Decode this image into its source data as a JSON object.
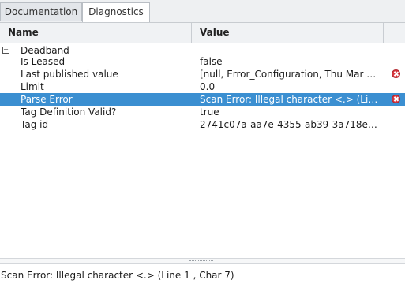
{
  "tabs": [
    {
      "label": "Documentation",
      "active": false
    },
    {
      "label": "Diagnostics",
      "active": true
    }
  ],
  "table": {
    "columns": {
      "name": "Name",
      "value": "Value"
    },
    "rows": [
      {
        "name": "Deadband",
        "value": "",
        "expandable": true,
        "error": false,
        "selected": false
      },
      {
        "name": "Is Leased",
        "value": "false",
        "expandable": false,
        "error": false,
        "selected": false
      },
      {
        "name": "Last published value",
        "value": "[null, Error_Configuration, Thu Mar 28 ...",
        "expandable": false,
        "error": true,
        "selected": false
      },
      {
        "name": "Limit",
        "value": "0.0",
        "expandable": false,
        "error": false,
        "selected": false
      },
      {
        "name": "Parse Error",
        "value": "Scan Error: Illegal character <.> (Line ...",
        "expandable": false,
        "error": true,
        "selected": true
      },
      {
        "name": "Tag Definition Valid?",
        "value": "true",
        "expandable": false,
        "error": false,
        "selected": false
      },
      {
        "name": "Tag id",
        "value": "2741c07a-aa7e-4355-ab39-3a718e14...",
        "expandable": false,
        "error": false,
        "selected": false
      }
    ]
  },
  "icons": {
    "expander": "plus-expander-icon",
    "error": "error-circle-icon"
  },
  "colors": {
    "selection": "#3b8fd1",
    "error": "#d9363e",
    "accent": "#3b8fd1"
  },
  "detail": {
    "text": "Scan Error: Illegal character <.> (Line 1 , Char 7)"
  }
}
